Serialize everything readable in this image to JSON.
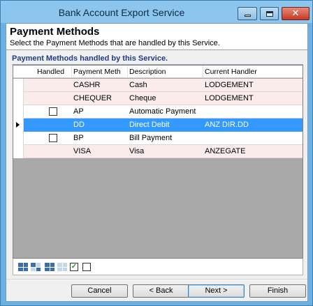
{
  "window": {
    "title": "Bank Account Export Service"
  },
  "header": {
    "title": "Payment Methods",
    "subtitle": "Select the Payment Methods that are handled by this Service."
  },
  "group": {
    "label": "Payment Methods handled by this Service."
  },
  "grid": {
    "columns": {
      "handled": "Handled",
      "code": "Payment Meth",
      "description": "Description",
      "handler": "Current Handler"
    },
    "rows": [
      {
        "code": "CASHR",
        "description": "Cash",
        "handler": "LODGEMENT",
        "checkbox": false,
        "checked": false,
        "state": "locked"
      },
      {
        "code": "CHEQUER",
        "description": "Cheque",
        "handler": "LODGEMENT",
        "checkbox": false,
        "checked": false,
        "state": "locked"
      },
      {
        "code": "AP",
        "description": "Automatic Payment",
        "handler": "",
        "checkbox": true,
        "checked": false,
        "state": "plain"
      },
      {
        "code": "DD",
        "description": "Direct Debit",
        "handler": "ANZ DIR.DD",
        "checkbox": false,
        "checked": false,
        "state": "selected"
      },
      {
        "code": "BP",
        "description": "Bill Payment",
        "handler": "",
        "checkbox": true,
        "checked": false,
        "state": "plain"
      },
      {
        "code": "VISA",
        "description": "Visa",
        "handler": "ANZEGATE",
        "checkbox": false,
        "checked": false,
        "state": "locked"
      }
    ]
  },
  "toolbar": {
    "icons": [
      "expand-all-icon",
      "collapse-all-icon",
      "expand-selected-icon",
      "collapse-selected-icon"
    ],
    "check_all": "✓",
    "uncheck_all": ""
  },
  "buttons": {
    "cancel": "Cancel",
    "back": "< Back",
    "next": "Next >",
    "finish": "Finish"
  },
  "colors": {
    "selected_row": "#3399ff",
    "locked_row": "#fbecec",
    "grid_background": "#a8a8a8",
    "group_label": "#1f3b87"
  }
}
